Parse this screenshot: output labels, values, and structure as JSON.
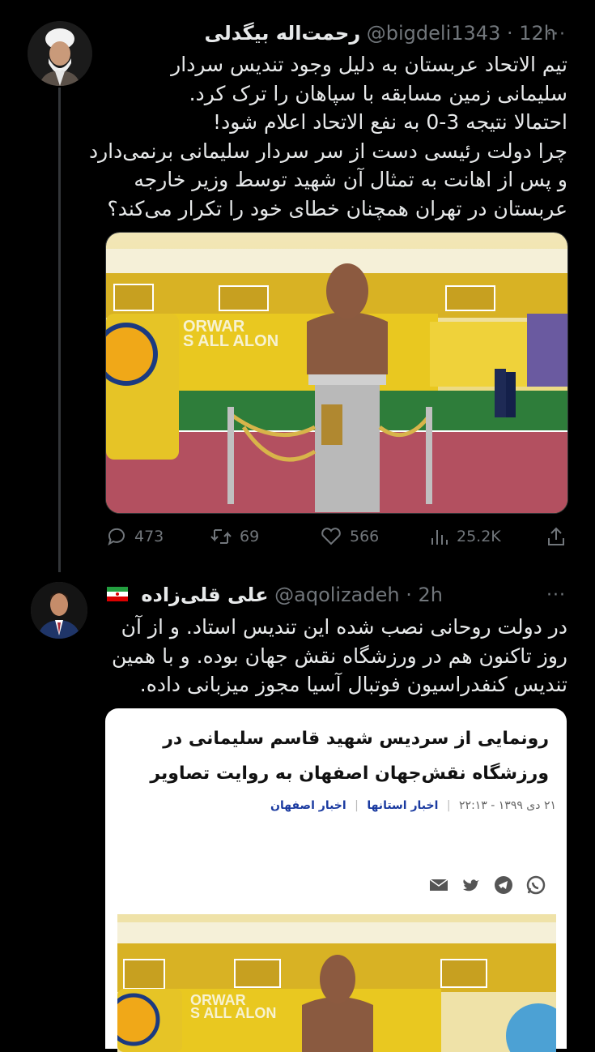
{
  "tweet1": {
    "name": "رحمت‌اله بیگدلی",
    "handle": "@bigdeli1343",
    "time": "· 12h",
    "more": "···",
    "lines": [
      "تیم الاتحاد عربستان به دلیل وجود تندیس سردار",
      "سلیمانی زمین مسابقه با سپاهان را ترک کرد.",
      "احتمالا نتیجه 3-0 به نفع الاتحاد اعلام شود!",
      "چرا دولت رئیسی دست از سر سردار سلیمانی برنمی‌دارد",
      "و پس از اهانت به تمثال آن شهید توسط وزیر خارجه",
      "عربستان در تهران همچنان خطای خود را تکرار می‌کند؟"
    ],
    "banner_left": "ORWAR",
    "banner_left2": "S ALL ALON",
    "stats": {
      "replies": "473",
      "retweets": "69",
      "likes": "566",
      "views": "25.2K"
    }
  },
  "tweet2": {
    "name": "علی قلی‌زاده",
    "handle": "@aqolizadeh",
    "time": "· 2h",
    "more": "···",
    "flag": "iran-flag",
    "lines": [
      "در دولت روحانی نصب شده این تندیس استاد. و از آن",
      "روز تاکنون هم در ورزشگاه نقش جهان بوده. و با همین",
      "تندیس کنفدراسیون فوتبال آسیا مجوز میزبانی داده."
    ],
    "card": {
      "title_lines": [
        "رونمایی از سردیس شهید قاسم سلیمانی در",
        "ورزشگاه نقش‌جهان اصفهان به روایت تصاویر"
      ],
      "date": "۲۱ دی ۱۳۹۹ - ۲۲:۱۳",
      "category1": "اخبار استانها",
      "category2": "اخبار اصفهان",
      "share_icons": [
        "whatsapp-icon",
        "telegram-icon",
        "twitter-icon",
        "email-icon"
      ],
      "banner_left": "ORWAR",
      "banner_left2": "S ALL ALON"
    }
  },
  "colors": {
    "background": "#000000",
    "text": "#e7e9ea",
    "muted": "#71767b",
    "stadium_yellow": "#e8c21a",
    "pitch_green": "#2e7d3a"
  }
}
